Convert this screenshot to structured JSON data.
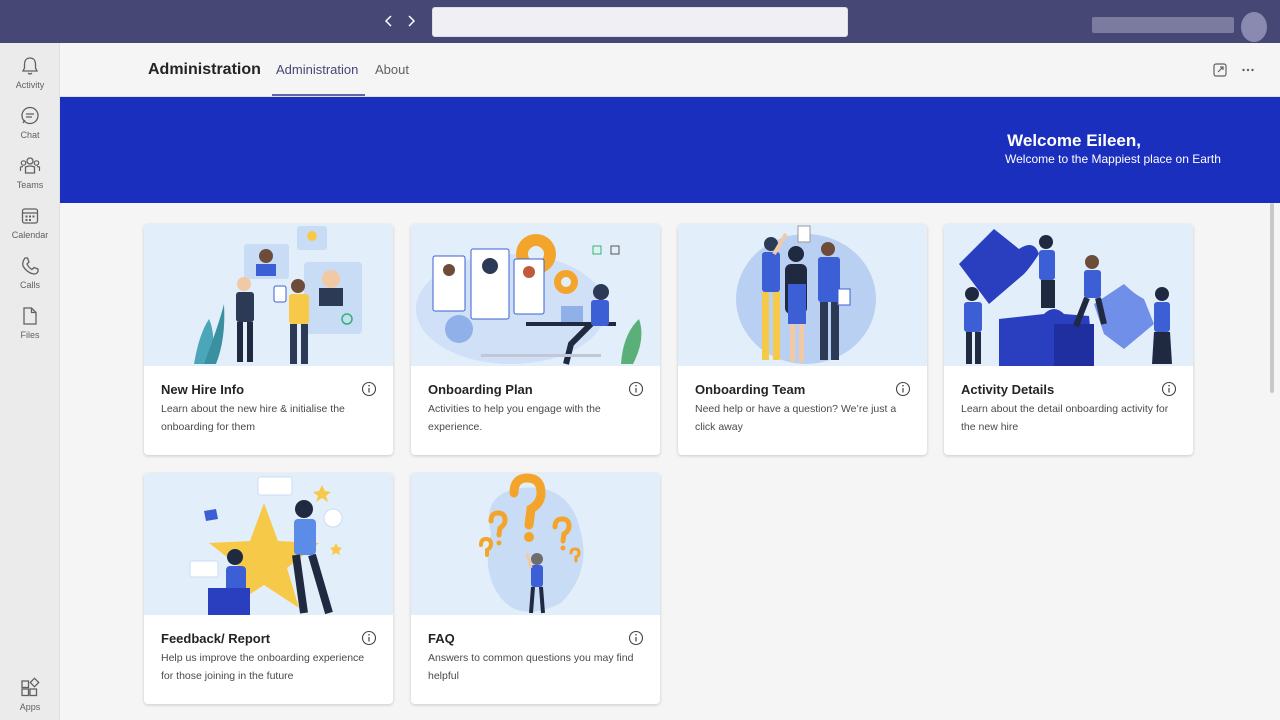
{
  "titlebar": {
    "back_icon": "chevron-left-icon",
    "forward_icon": "chevron-right-icon",
    "search_placeholder": ""
  },
  "rail": {
    "items": [
      {
        "label": "Activity",
        "icon": "bell-icon"
      },
      {
        "label": "Chat",
        "icon": "chat-icon"
      },
      {
        "label": "Teams",
        "icon": "teams-icon"
      },
      {
        "label": "Calendar",
        "icon": "calendar-icon"
      },
      {
        "label": "Calls",
        "icon": "phone-icon"
      },
      {
        "label": "Files",
        "icon": "file-icon"
      }
    ],
    "apps": {
      "label": "Apps",
      "icon": "apps-icon"
    }
  },
  "header": {
    "title": "Administration",
    "tabs": [
      {
        "label": "Administration",
        "active": true
      },
      {
        "label": "About",
        "active": false
      }
    ],
    "popout_icon": "popout-icon",
    "more_icon": "more-icon"
  },
  "banner": {
    "title": "Welcome Eileen,",
    "subtitle": "Welcome to the Mappiest place on Earth",
    "color": "#1b2fbf"
  },
  "cards": [
    {
      "title": "New Hire Info",
      "description": "Learn about the new hire & initialise the onboarding for them"
    },
    {
      "title": "Onboarding Plan",
      "description": "Activities to help you engage with the       experience."
    },
    {
      "title": "Onboarding Team",
      "description": "Need help or have a question? We’re just a click away"
    },
    {
      "title": "Activity Details",
      "description": "Learn about the detail onboarding activity for the new hire"
    },
    {
      "title": "Feedback/ Report",
      "description": "Help us improve the onboarding experience for those joining in the future"
    },
    {
      "title": "FAQ",
      "description": "Answers to common questions you may find helpful"
    }
  ],
  "colors": {
    "titlebar": "#464775",
    "accent": "#6264a7",
    "illustration_blue": "#3d5fd6",
    "illustration_yellow": "#f7c948"
  }
}
